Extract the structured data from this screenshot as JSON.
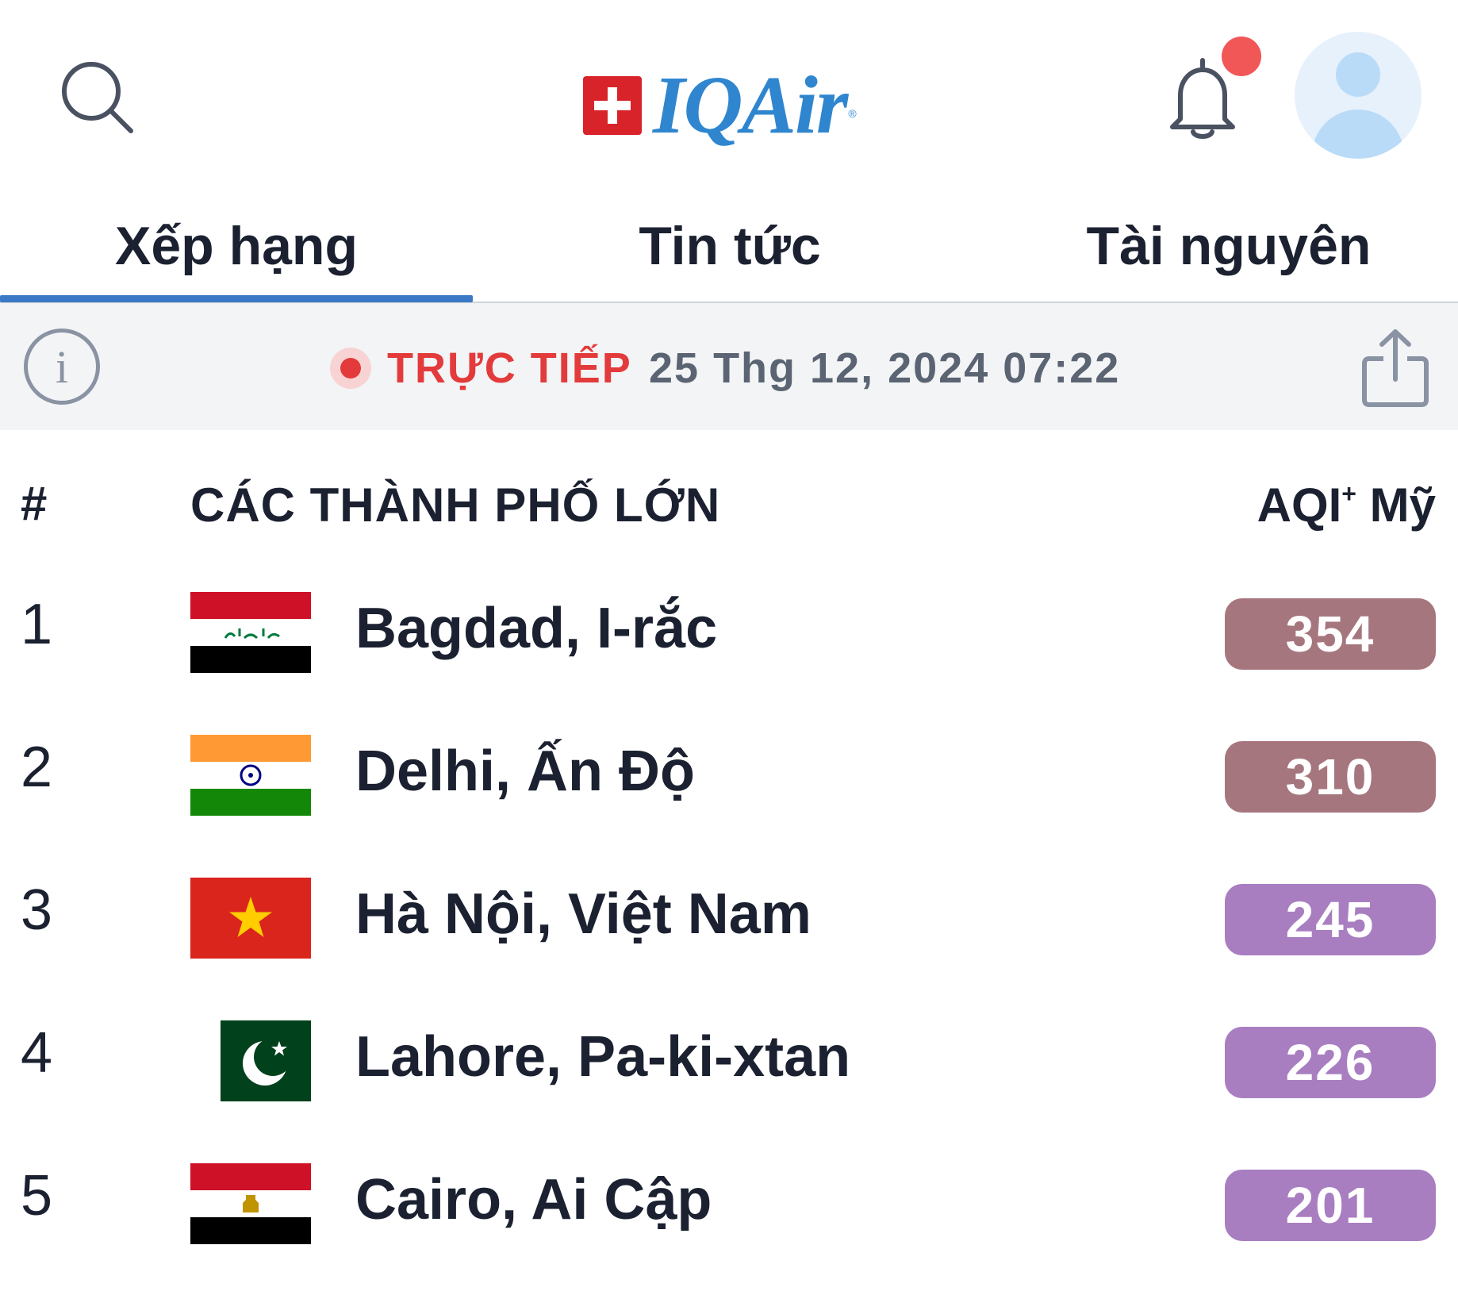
{
  "header": {
    "logo_text": "IQAir",
    "logo_reg": "®",
    "brand_color": "#2f86cf",
    "has_notification": true
  },
  "tabs": [
    {
      "label": "Xếp hạng",
      "active": true
    },
    {
      "label": "Tin tức",
      "active": false
    },
    {
      "label": "Tài nguyên",
      "active": false
    }
  ],
  "live": {
    "label": "TRỰC TIẾP",
    "timestamp": "25 Thg 12, 2024 07:22",
    "color": "#e33b3b"
  },
  "table": {
    "col_rank": "#",
    "col_city": "CÁC THÀNH PHỐ LỚN",
    "col_aqi": "AQI",
    "col_aqi_sup": "+",
    "col_aqi_suffix": " Mỹ",
    "rows": [
      {
        "rank": "1",
        "city": "Bagdad, I-rắc",
        "flag": "iraq-flag",
        "aqi": "354",
        "aqi_color": "#a6767f"
      },
      {
        "rank": "2",
        "city": "Delhi, Ấn Độ",
        "flag": "india-flag",
        "aqi": "310",
        "aqi_color": "#a6767f"
      },
      {
        "rank": "3",
        "city": "Hà Nội, Việt Nam",
        "flag": "vietnam-flag",
        "aqi": "245",
        "aqi_color": "#a87ec1"
      },
      {
        "rank": "4",
        "city": "Lahore, Pa-ki-xtan",
        "flag": "pakistan-flag",
        "aqi": "226",
        "aqi_color": "#a87ec1"
      },
      {
        "rank": "5",
        "city": "Cairo, Ai Cập",
        "flag": "egypt-flag",
        "aqi": "201",
        "aqi_color": "#a87ec1"
      }
    ]
  }
}
